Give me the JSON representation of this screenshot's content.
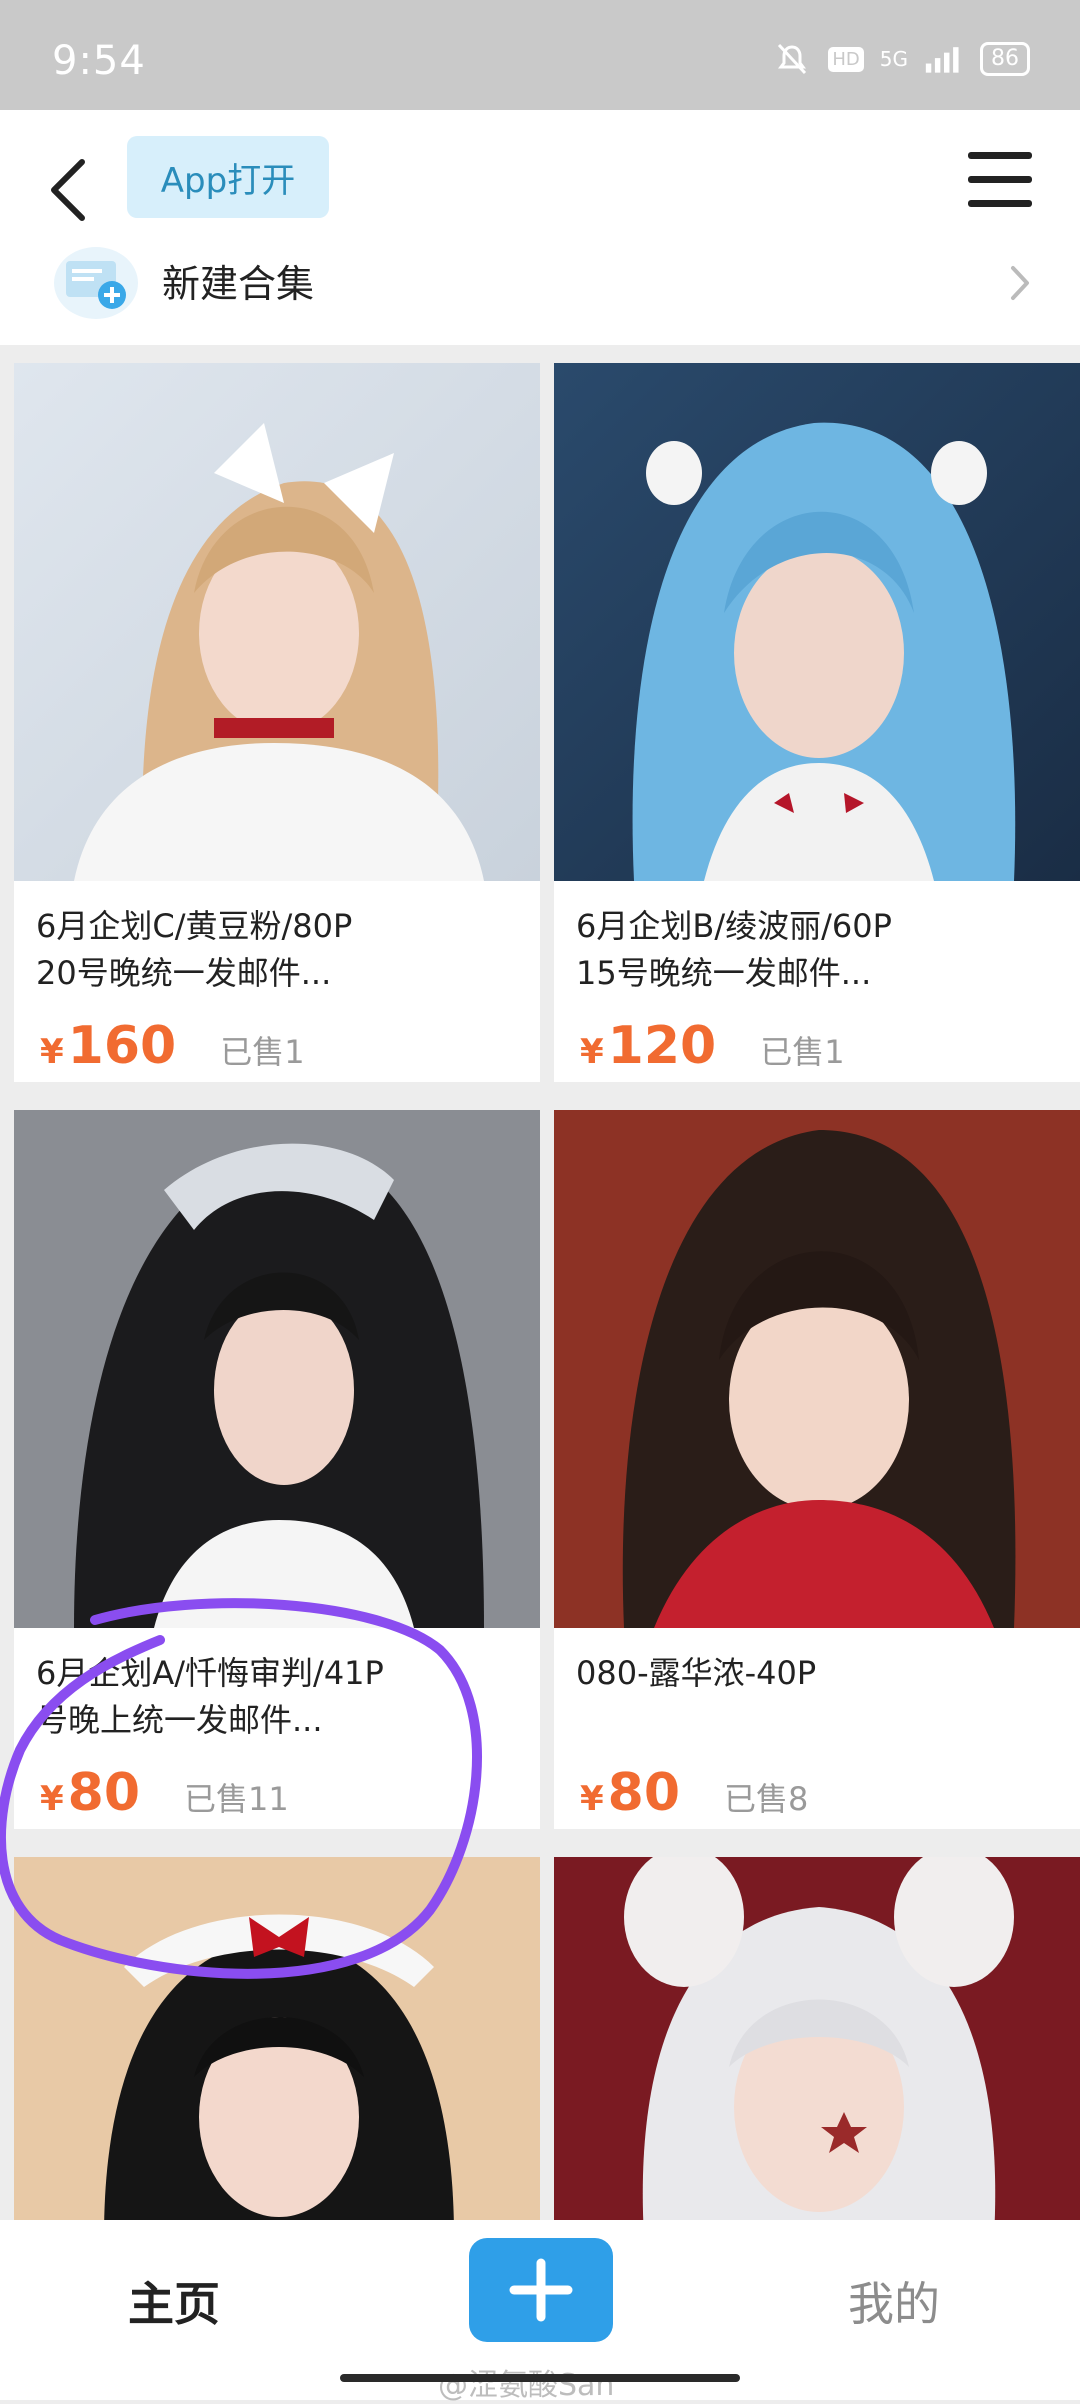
{
  "status_bar": {
    "time": "9:54",
    "battery": "86",
    "network": "5G",
    "hd": "HD"
  },
  "header": {
    "open_in_app": "App打开",
    "new_collection": "新建合集"
  },
  "products": [
    {
      "title_line1": "6月企划C/黄豆粉/80P",
      "title_line2": "20号晚统一发邮件...",
      "currency": "¥",
      "price": "160",
      "sold": "已售1"
    },
    {
      "title_line1": "6月企划B/绫波丽/60P",
      "title_line2": "15号晚统一发邮件...",
      "currency": "¥",
      "price": "120",
      "sold": "已售1"
    },
    {
      "title_line1": "6月企划A/忏悔审判/41P",
      "title_line2": "号晚上统一发邮件...",
      "currency": "¥",
      "price": "80",
      "sold": "已售11"
    },
    {
      "title_line1": "080-露华浓-40P",
      "title_line2": "",
      "currency": "¥",
      "price": "80",
      "sold": "已售8"
    }
  ],
  "bottom_nav": {
    "home": "主页",
    "mine": "我的",
    "watermark": "@涩氨酸San"
  },
  "colors": {
    "accent": "#f16b31",
    "primary_blue": "#2f9fe8",
    "annotation": "#8a4df0"
  },
  "icons": [
    "back-arrow-icon",
    "hamburger-menu-icon",
    "collection-icon",
    "chevron-right-icon",
    "plus-icon",
    "mute-bell-icon",
    "signal-icon",
    "battery-icon"
  ]
}
